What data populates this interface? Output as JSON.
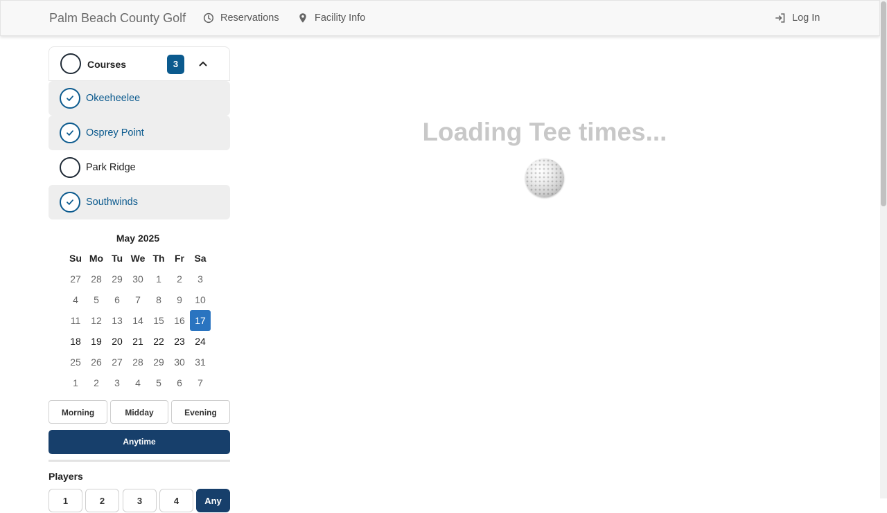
{
  "nav": {
    "brand": "Palm Beach County Golf",
    "reservations": "Reservations",
    "facility_info": "Facility Info",
    "login": "Log In"
  },
  "courses": {
    "title": "Courses",
    "selected_count": "3",
    "items": [
      {
        "label": "Okeeheelee",
        "selected": true
      },
      {
        "label": "Osprey Point",
        "selected": true
      },
      {
        "label": "Park Ridge",
        "selected": false
      },
      {
        "label": "Southwinds",
        "selected": true
      }
    ]
  },
  "calendar": {
    "month_label": "May 2025",
    "weekdays": [
      "Su",
      "Mo",
      "Tu",
      "We",
      "Th",
      "Fr",
      "Sa"
    ],
    "weeks": [
      [
        "27",
        "28",
        "29",
        "30",
        "1",
        "2",
        "3"
      ],
      [
        "4",
        "5",
        "6",
        "7",
        "8",
        "9",
        "10"
      ],
      [
        "11",
        "12",
        "13",
        "14",
        "15",
        "16",
        "17"
      ],
      [
        "18",
        "19",
        "20",
        "21",
        "22",
        "23",
        "24"
      ],
      [
        "25",
        "26",
        "27",
        "28",
        "29",
        "30",
        "31"
      ],
      [
        "1",
        "2",
        "3",
        "4",
        "5",
        "6",
        "7"
      ]
    ],
    "selected_day": "17"
  },
  "time_filters": {
    "morning": "Morning",
    "midday": "Midday",
    "evening": "Evening",
    "anytime": "Anytime"
  },
  "players": {
    "title": "Players",
    "options": [
      "1",
      "2",
      "3",
      "4",
      "Any"
    ]
  },
  "main": {
    "loading_text": "Loading Tee times..."
  },
  "colors": {
    "accent": "#0b5a8e",
    "dark_button": "#173f6b",
    "calendar_selected": "#2a74c0",
    "loading_text": "#c8c8c8"
  },
  "icons": {
    "reservations": "clock-icon",
    "facility_info": "map-pin-icon",
    "login": "login-arrow-icon",
    "collapse": "chevron-up-icon",
    "check": "checkmark-icon",
    "loading": "golf-ball-icon"
  }
}
